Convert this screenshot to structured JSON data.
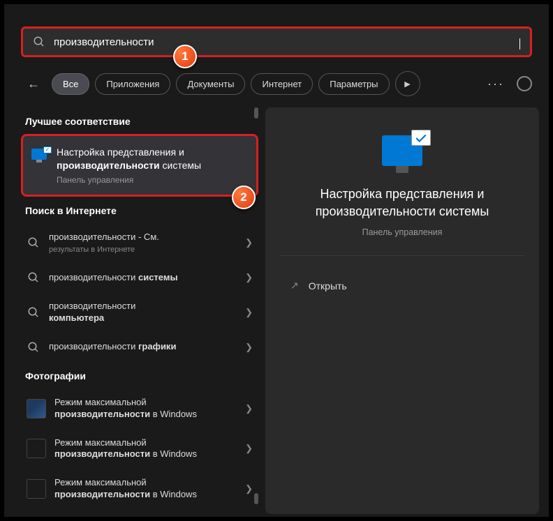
{
  "search": {
    "query": "производительности"
  },
  "filters": {
    "all": "Все",
    "apps": "Приложения",
    "docs": "Документы",
    "web": "Интернет",
    "settings": "Параметры"
  },
  "sections": {
    "best": "Лучшее соответствие",
    "web": "Поиск в Интернете",
    "photos": "Фотографии"
  },
  "best_match": {
    "line1": "Настройка представления и",
    "bold": "производительности",
    "line2_rest": " системы",
    "subtitle": "Панель управления"
  },
  "web_results": [
    {
      "prefix": "производительности",
      "suffix": " - См.",
      "sub": "результаты в Интернете"
    },
    {
      "prefix": "производительности ",
      "bold": "системы"
    },
    {
      "prefix": "производительности",
      "sub": null,
      "bold2_pre": "",
      "second_line_bold": "компьютера"
    },
    {
      "prefix": "производительности ",
      "bold": "графики"
    }
  ],
  "photo_results": [
    {
      "line1": "Режим максимальной",
      "bold": "производительности",
      "rest": " в Windows"
    },
    {
      "line1": "Режим максимальной",
      "bold": "производительности",
      "rest": " в Windows"
    },
    {
      "line1": "Режим максимальной",
      "bold": "производительности",
      "rest": " в Windows"
    }
  ],
  "preview": {
    "title": "Настройка представления и производительности системы",
    "subtitle": "Панель управления",
    "open": "Открыть"
  },
  "markers": {
    "one": "1",
    "two": "2"
  }
}
